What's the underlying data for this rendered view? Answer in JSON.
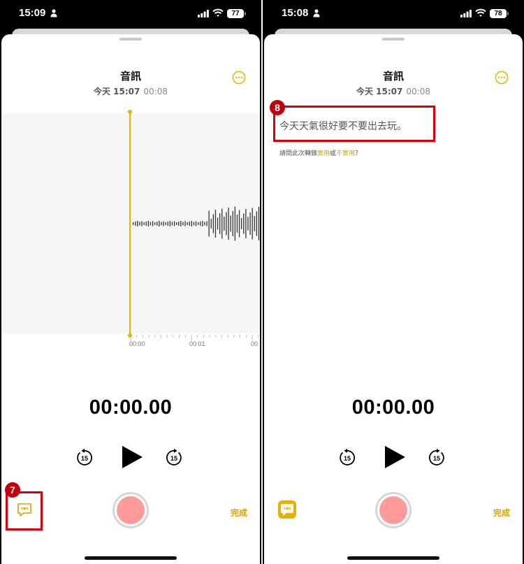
{
  "left": {
    "status": {
      "time": "15:09",
      "battery": "77"
    },
    "title": "音訊",
    "date": "今天 15:07",
    "duration": "00:08",
    "timeline": [
      "00:00",
      "00:01",
      "00"
    ],
    "time_display": "00:00.00",
    "done_label": "完成",
    "badge": "7"
  },
  "right": {
    "status": {
      "time": "15:08",
      "battery": "78"
    },
    "title": "音訊",
    "date": "今天 15:07",
    "duration": "00:08",
    "transcript": "今天天氣很好要不要出去玩。",
    "feedback_prefix": "請問此次轉錄",
    "feedback_useful": "實用",
    "feedback_or": "或",
    "feedback_not_useful": "不實用",
    "feedback_suffix": "？",
    "time_display": "00:00.00",
    "done_label": "完成",
    "badge": "8"
  },
  "icons": {
    "skip_back": "skip-back-15-icon",
    "skip_forward": "skip-forward-15-icon",
    "skip_amount": "15",
    "play": "play-icon",
    "more": "ellipsis-circle-icon",
    "transcript": "quote-bubble-icon"
  },
  "colors": {
    "accent": "#e8b400",
    "record": "#ff9a9a",
    "highlight": "#d7000f"
  }
}
